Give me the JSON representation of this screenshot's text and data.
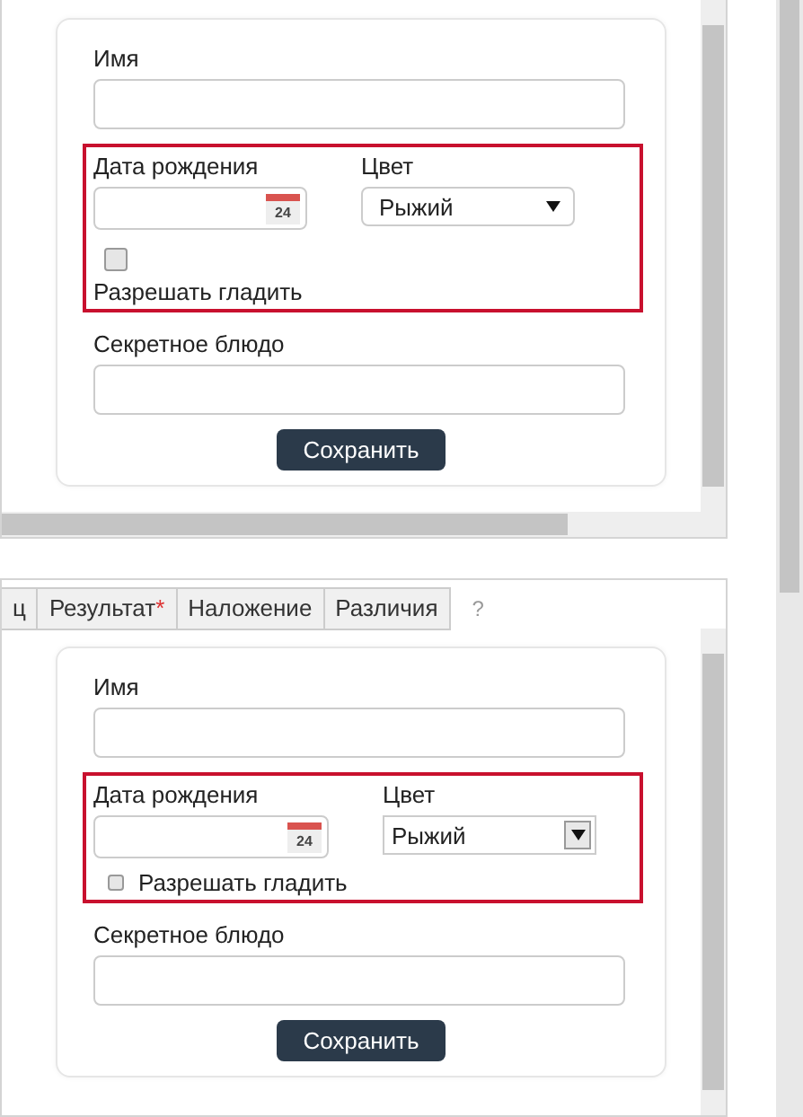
{
  "panels": [
    {
      "name_label": "Имя",
      "date_label": "Дата рождения",
      "calendar_day": "24",
      "color_label": "Цвет",
      "color_select": {
        "kind": "flat",
        "value": "Рыжий"
      },
      "checkbox": {
        "kind": "stacked",
        "label": "Разрешать гладить",
        "checked": false
      },
      "secret_label": "Секретное блюдо",
      "save_button": "Сохранить"
    },
    {
      "tabs": [
        {
          "label": "ц",
          "selected": false
        },
        {
          "label": "Результат",
          "required_mark": "*",
          "selected": false
        },
        {
          "label": "Наложение",
          "selected": false
        },
        {
          "label": "Различия",
          "selected": false
        }
      ],
      "help": "?",
      "name_label": "Имя",
      "date_label": "Дата рождения",
      "calendar_day": "24",
      "color_label": "Цвет",
      "color_select": {
        "kind": "classic",
        "value": "Рыжий"
      },
      "checkbox": {
        "kind": "inline",
        "label": "Разрешать гладить",
        "checked": false
      },
      "secret_label": "Секретное блюдо",
      "save_button": "Сохранить"
    }
  ]
}
